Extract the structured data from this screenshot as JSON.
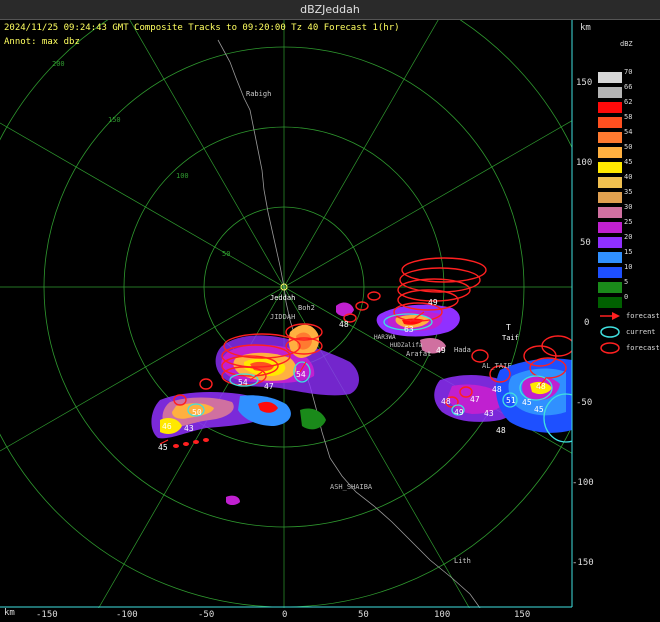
{
  "window": {
    "title": "dBZJeddah"
  },
  "header": {
    "line1": "2024/11/25 09:24:43 GMT Composite Tracks to 09:20:00 Tz 40 Forecast 1(hr)",
    "line2": "Annot: max dbz"
  },
  "units": {
    "top": "km",
    "bottom": "km"
  },
  "legend": {
    "title": "dBZ",
    "scale": [
      {
        "v": "70",
        "c": "#d7d7d7"
      },
      {
        "v": "66",
        "c": "#b4b4b4"
      },
      {
        "v": "62",
        "c": "#ff0a0a"
      },
      {
        "v": "58",
        "c": "#ff5020"
      },
      {
        "v": "54",
        "c": "#ff7a30"
      },
      {
        "v": "50",
        "c": "#ffb040"
      },
      {
        "v": "45",
        "c": "#ffe800"
      },
      {
        "v": "40",
        "c": "#f0c050"
      },
      {
        "v": "35",
        "c": "#e0a050"
      },
      {
        "v": "30",
        "c": "#d070a0"
      },
      {
        "v": "25",
        "c": "#c020d0"
      },
      {
        "v": "20",
        "c": "#9030ff"
      },
      {
        "v": "15",
        "c": "#3090ff"
      },
      {
        "v": "10",
        "c": "#1e50ff"
      },
      {
        "v": "5",
        "c": "#1a8a1a"
      },
      {
        "v": "0",
        "c": "#006000"
      }
    ],
    "keys": [
      {
        "label": "forecast",
        "type": "arrow",
        "color": "#ff2020"
      },
      {
        "label": "current",
        "type": "ellipse",
        "color": "#40e0e0"
      },
      {
        "label": "forecast",
        "type": "ellipse",
        "color": "#ff2020"
      }
    ]
  },
  "axes": {
    "x_ticks": [
      "-150",
      "-100",
      "-50",
      "0",
      "50",
      "100",
      "150"
    ],
    "y_ticks": [
      "150",
      "100",
      "50",
      "0",
      "-50",
      "-100",
      "-150"
    ],
    "range_labels": [
      "50",
      "100",
      "150",
      "200"
    ]
  },
  "places": [
    {
      "name": "Rabigh"
    },
    {
      "name": "Jeddah"
    },
    {
      "name": "JIDDAH"
    },
    {
      "name": "Boh2"
    },
    {
      "name": "HAR3WA"
    },
    {
      "name": "HUDZalifa"
    },
    {
      "name": "Arafat"
    },
    {
      "name": "Hada"
    },
    {
      "name": "T"
    },
    {
      "name": "Taif"
    },
    {
      "name": "AL_TAIF"
    },
    {
      "name": "ASH_SHAIBA"
    },
    {
      "name": "Lith"
    }
  ],
  "cells": [
    {
      "dbz": "49"
    },
    {
      "dbz": "48"
    },
    {
      "dbz": "63"
    },
    {
      "dbz": "49"
    },
    {
      "dbz": "54"
    },
    {
      "dbz": "47"
    },
    {
      "dbz": "54"
    },
    {
      "dbz": "50"
    },
    {
      "dbz": "46"
    },
    {
      "dbz": "43"
    },
    {
      "dbz": "45"
    },
    {
      "dbz": "48"
    },
    {
      "dbz": "48"
    },
    {
      "dbz": "47"
    },
    {
      "dbz": "49"
    },
    {
      "dbz": "43"
    },
    {
      "dbz": "51"
    },
    {
      "dbz": "45"
    },
    {
      "dbz": "45"
    },
    {
      "dbz": "48"
    },
    {
      "dbz": "48"
    }
  ]
}
